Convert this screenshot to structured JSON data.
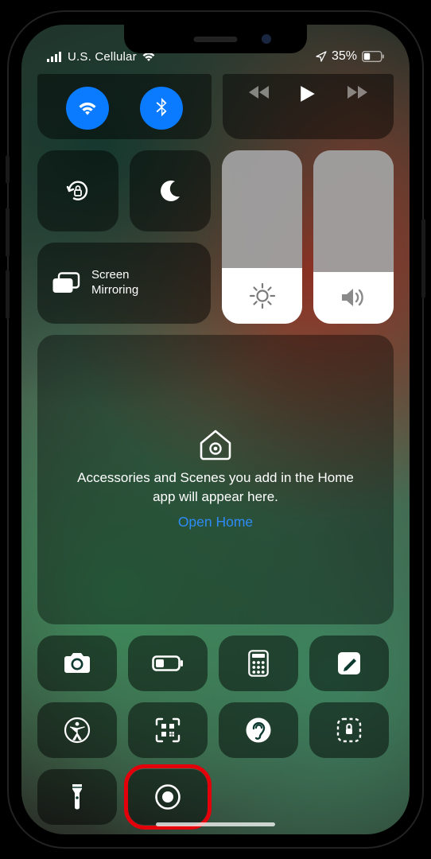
{
  "status": {
    "carrier": "U.S. Cellular",
    "batteryPercent": "35%"
  },
  "screenMirroring": {
    "label": "Screen\nMirroring"
  },
  "brightness": {
    "level": 0.32
  },
  "volume": {
    "level": 0.3
  },
  "home": {
    "message": "Accessories and Scenes you add in the Home app will appear here.",
    "link": "Open Home"
  },
  "connectivity": {
    "wifiOn": true,
    "bluetoothOn": true
  },
  "colors": {
    "toggleOn": "#0a7aff",
    "link": "#2d8cf6",
    "highlight": "#e3000b"
  }
}
